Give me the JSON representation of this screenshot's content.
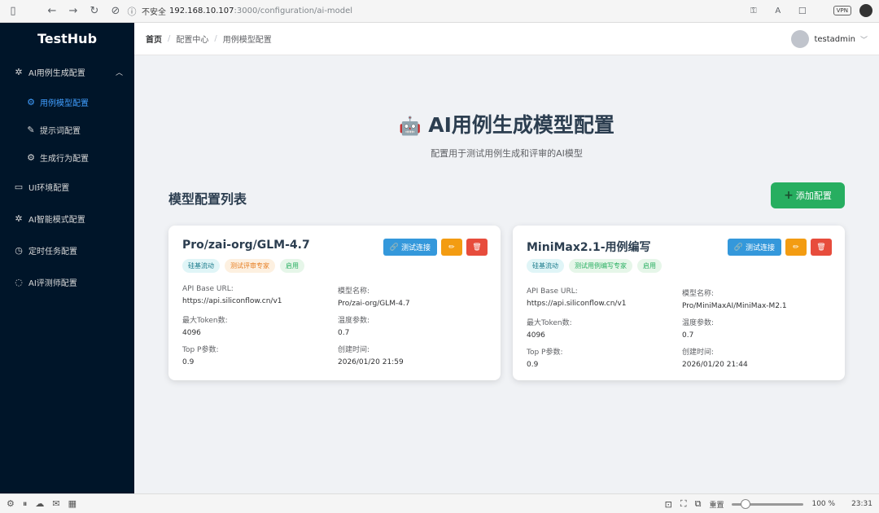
{
  "browser": {
    "insecure_label": "不安全",
    "url_host": "192.168.10.107",
    "url_path": ":3000/configuration/ai-model",
    "vpn_label": "VPN"
  },
  "sidebar": {
    "logo": "TestHub",
    "groups": [
      {
        "label": "AI用例生成配置",
        "icon": "sparkle-icon",
        "expanded": true,
        "children": [
          {
            "label": "用例模型配置",
            "icon": "gear-icon",
            "active": true
          },
          {
            "label": "提示词配置",
            "icon": "edit-icon"
          },
          {
            "label": "生成行为配置",
            "icon": "settings-icon"
          }
        ]
      },
      {
        "label": "UI环境配置",
        "icon": "monitor-icon"
      },
      {
        "label": "AI智能模式配置",
        "icon": "sparkle-icon"
      },
      {
        "label": "定时任务配置",
        "icon": "timer-icon"
      },
      {
        "label": "AI评测师配置",
        "icon": "chat-icon"
      }
    ]
  },
  "header": {
    "breadcrumb": [
      "首页",
      "配置中心",
      "用例模型配置"
    ],
    "username": "testadmin"
  },
  "main": {
    "title_icon": "🤖",
    "title": "AI用例生成模型配置",
    "subtitle": "配置用于测试用例生成和评审的AI模型",
    "list_title": "模型配置列表",
    "add_label": "添加配置",
    "add_icon": "+",
    "test_label": "测试连接",
    "cards": [
      {
        "name": "Pro/zai-org/GLM-4.7",
        "tags": [
          {
            "label": "硅基流动",
            "color": "teal"
          },
          {
            "label": "测试评审专家",
            "color": "orange"
          },
          {
            "label": "启用",
            "color": "green"
          }
        ],
        "fields": {
          "base_url_label": "API Base URL:",
          "base_url": "https://api.siliconflow.cn/v1",
          "model_name_label": "模型名称:",
          "model_name": "Pro/zai-org/GLM-4.7",
          "max_token_label": "最大Token数:",
          "max_token": "4096",
          "temp_label": "温度参数:",
          "temp": "0.7",
          "top_p_label": "Top P参数:",
          "top_p": "0.9",
          "created_label": "创建时间:",
          "created": "2026/01/20 21:59"
        }
      },
      {
        "name": "MiniMax2.1-用例编写",
        "tags": [
          {
            "label": "硅基流动",
            "color": "teal"
          },
          {
            "label": "测试用例编写专家",
            "color": "green"
          },
          {
            "label": "启用",
            "color": "green"
          }
        ],
        "fields": {
          "base_url_label": "API Base URL:",
          "base_url": "https://api.siliconflow.cn/v1",
          "model_name_label": "模型名称:",
          "model_name": "Pro/MiniMaxAI/MiniMax-M2.1",
          "max_token_label": "最大Token数:",
          "max_token": "4096",
          "temp_label": "温度参数:",
          "temp": "0.7",
          "top_p_label": "Top P参数:",
          "top_p": "0.9",
          "created_label": "创建时间:",
          "created": "2026/01/20 21:44"
        }
      }
    ]
  },
  "dock": {
    "reset_label": "重置",
    "zoom": "100 %",
    "zoom_level": 0.12,
    "time": "23:31"
  },
  "colors": {
    "sidebar_bg": "#001529",
    "active": "#409eff",
    "add_button": "#27ae60",
    "test_button": "#3498db",
    "edit_button": "#f39c12",
    "delete_button": "#e74c3c"
  }
}
